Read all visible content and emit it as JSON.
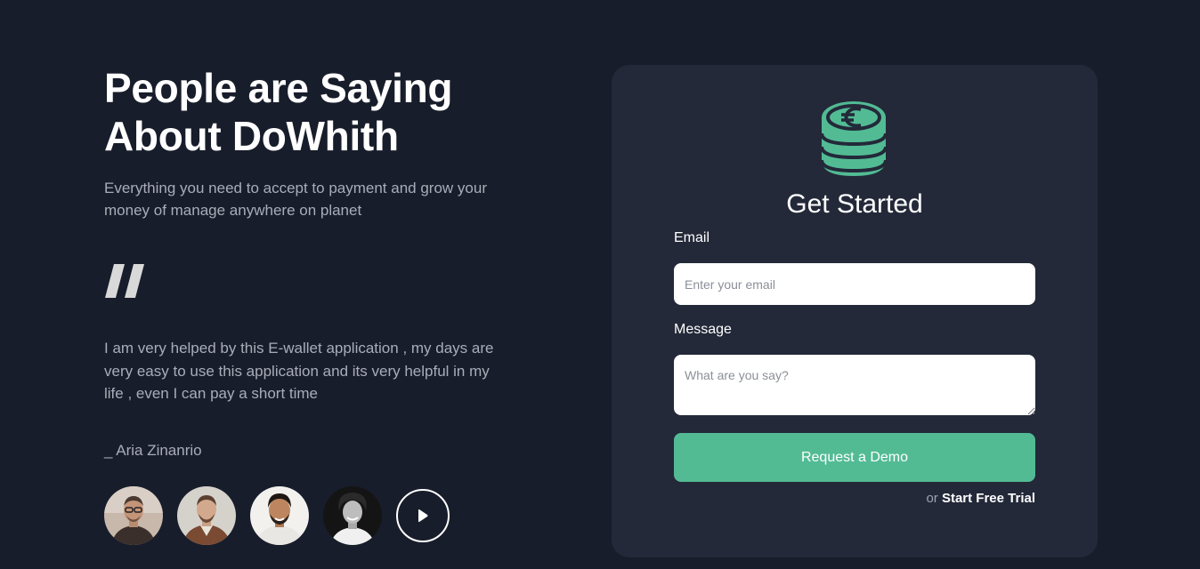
{
  "testimonial": {
    "title_line1": "People are Saying",
    "title_line2": "About DoWhith",
    "subtitle": "Everything you need to accept to payment and grow your money of manage anywhere on planet",
    "quote_icon": "quote-icon",
    "quote": "I am very helped by this E-wallet application , my days are very easy to use this application and its very helpful in my life , even I can pay a short time",
    "author": "_ Aria Zinanrio",
    "avatars": [
      "avatar-1",
      "avatar-2",
      "avatar-3",
      "avatar-4"
    ],
    "play_icon": "play-icon"
  },
  "form": {
    "logo_icon": "euro-coin-stack-icon",
    "title": "Get Started",
    "email_label": "Email",
    "email_placeholder": "Enter your email",
    "email_value": "",
    "message_label": "Message",
    "message_placeholder": "What are you say?",
    "message_value": "",
    "submit_label": "Request a Demo",
    "or_text": "or",
    "trial_link": "Start Free Trial"
  },
  "colors": {
    "background": "#181d2b",
    "card": "#232939",
    "accent": "#52bb94",
    "muted_text": "#a9adb8"
  }
}
